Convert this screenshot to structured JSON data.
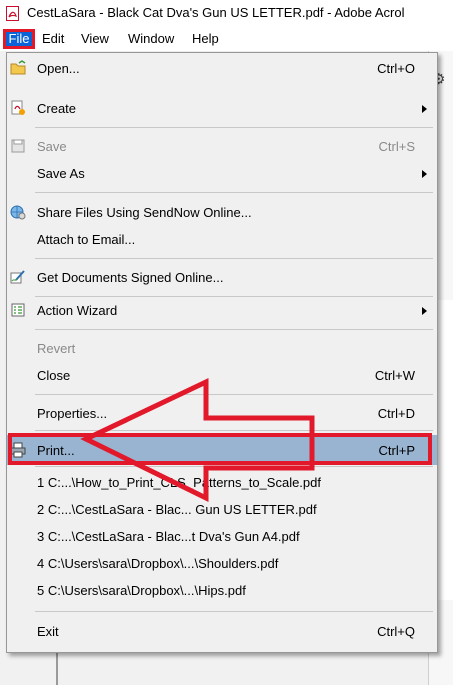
{
  "window": {
    "title": "CestLaSara - Black Cat Dva's Gun US LETTER.pdf - Adobe Acrol"
  },
  "menubar": {
    "items": [
      "File",
      "Edit",
      "View",
      "Window",
      "Help"
    ]
  },
  "file_menu": {
    "open": {
      "label": "Open...",
      "shortcut": "Ctrl+O"
    },
    "create": {
      "label": "Create"
    },
    "save": {
      "label": "Save",
      "shortcut": "Ctrl+S"
    },
    "save_as": {
      "label": "Save As"
    },
    "share": {
      "label": "Share Files Using SendNow Online..."
    },
    "attach": {
      "label": "Attach to Email..."
    },
    "signed": {
      "label": "Get Documents Signed Online..."
    },
    "wizard": {
      "label": "Action Wizard"
    },
    "revert": {
      "label": "Revert"
    },
    "close": {
      "label": "Close",
      "shortcut": "Ctrl+W"
    },
    "properties": {
      "label": "Properties...",
      "shortcut": "Ctrl+D"
    },
    "print": {
      "label": "Print...",
      "shortcut": "Ctrl+P"
    },
    "recent": [
      "1 C:...\\How_to_Print_CLS_Patterns_to_Scale.pdf",
      "2 C:...\\CestLaSara - Blac... Gun US LETTER.pdf",
      "3 C:...\\CestLaSara - Blac...t Dva's Gun A4.pdf",
      "4 C:\\Users\\sara\\Dropbox\\...\\Shoulders.pdf",
      "5 C:\\Users\\sara\\Dropbox\\...\\Hips.pdf"
    ],
    "exit": {
      "label": "Exit",
      "shortcut": "Ctrl+Q"
    }
  },
  "colors": {
    "highlight": "#99b4d1",
    "annotation_red": "#e1192b",
    "file_menu_active": "#0a64d8"
  }
}
